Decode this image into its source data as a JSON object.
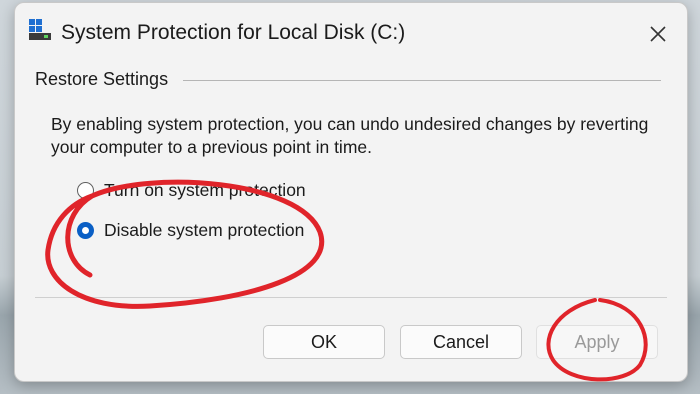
{
  "window": {
    "title": "System Protection for Local Disk (C:)",
    "icon": "drive-icon"
  },
  "restore_settings": {
    "group_label": "Restore Settings",
    "description": "By enabling system protection, you can undo undesired changes by reverting your computer to a previous point in time.",
    "options": [
      {
        "label": "Turn on system protection",
        "checked": false
      },
      {
        "label": "Disable system protection",
        "checked": true
      }
    ]
  },
  "buttons": {
    "ok": "OK",
    "cancel": "Cancel",
    "apply": "Apply",
    "apply_enabled": false
  },
  "colors": {
    "accent": "#0a5fc5",
    "annotation": "#e0242a"
  }
}
